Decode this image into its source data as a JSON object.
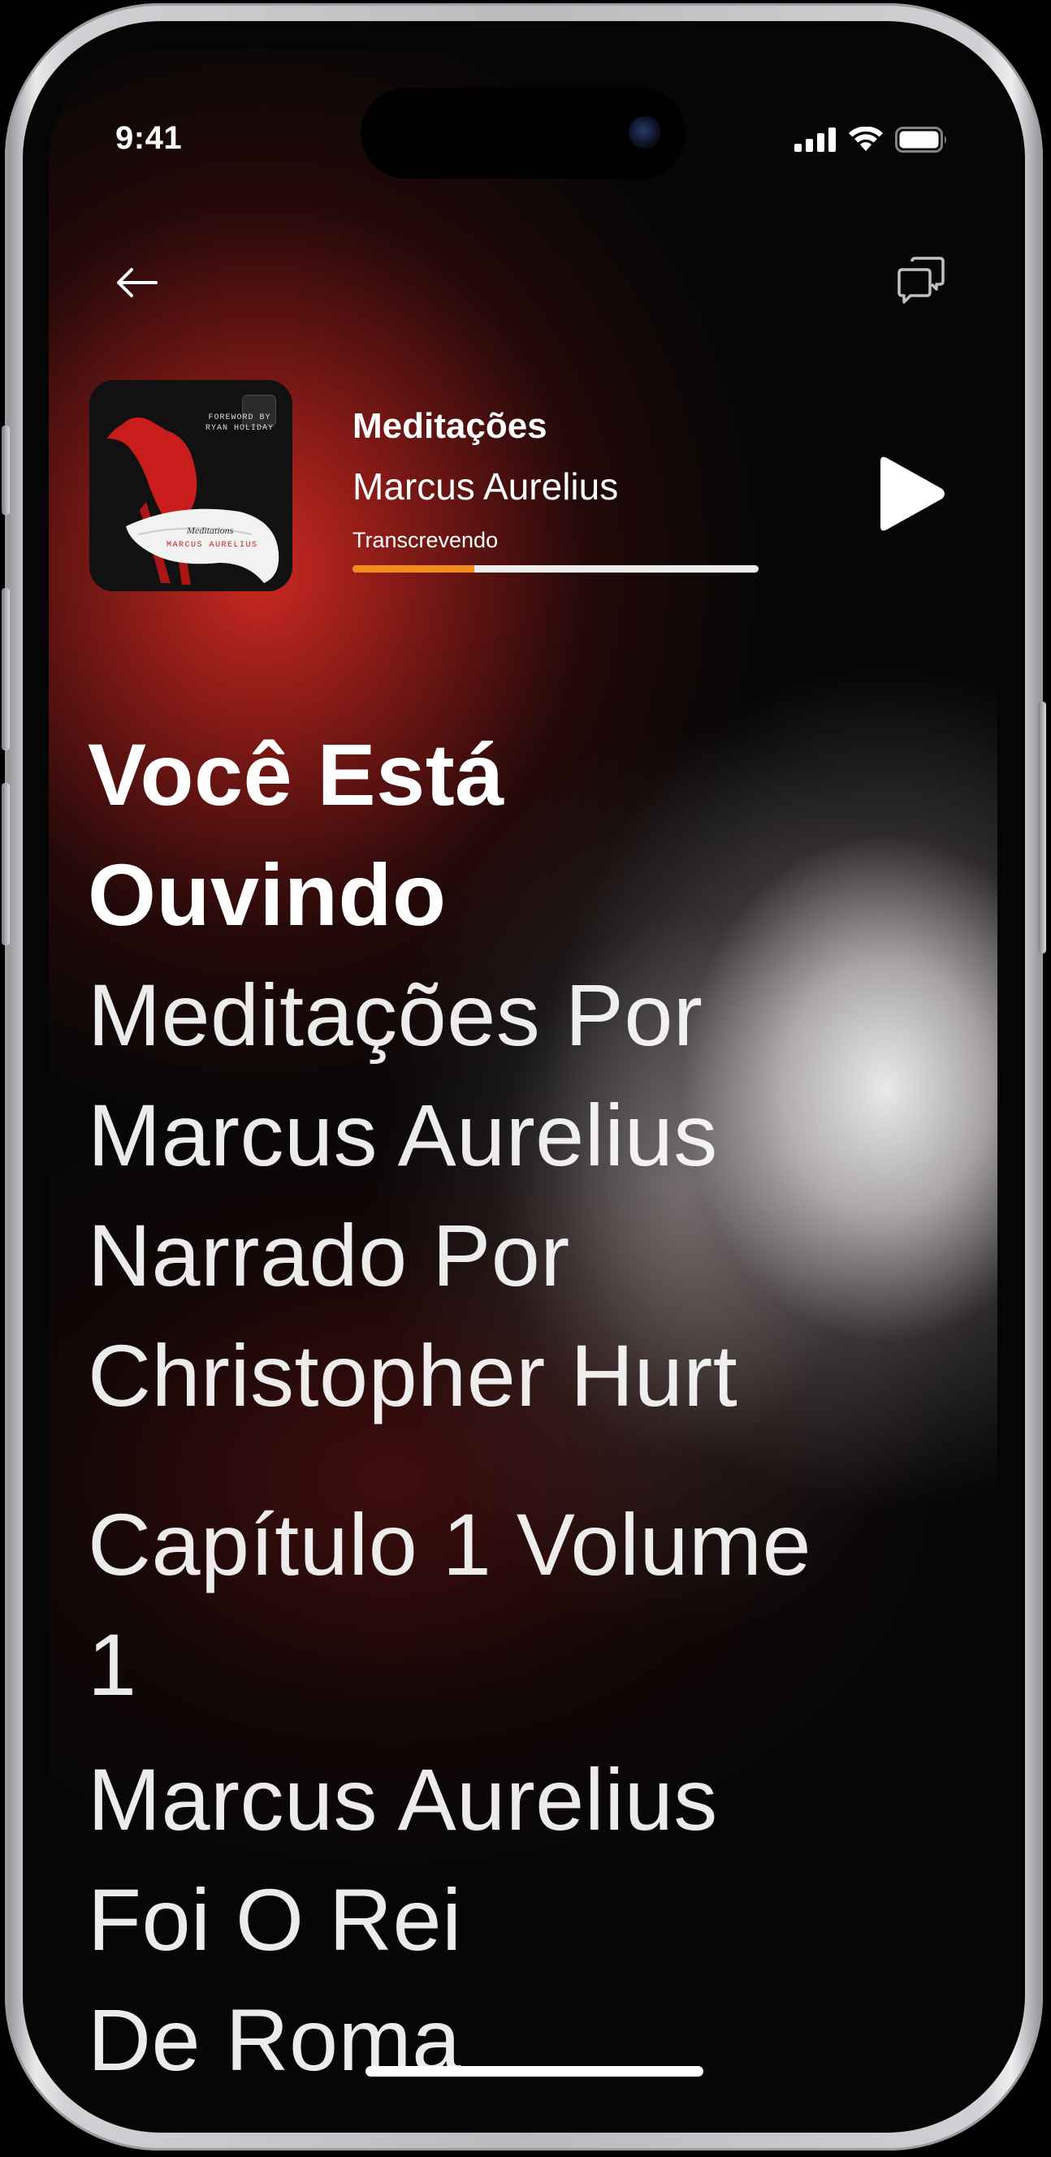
{
  "status_bar": {
    "time": "9:41",
    "icons": [
      "cellular-signal-icon",
      "wifi-icon",
      "battery-icon"
    ]
  },
  "header": {
    "back_icon": "arrow-left-icon",
    "chat_icon": "chat-bubbles-icon"
  },
  "now_playing": {
    "title": "Meditações",
    "author": "Marcus Aurelius",
    "status": "Transcrevendo",
    "progress": 0.3,
    "cover": {
      "top_text": "FOREWORD BY RYAN HOLIDAY",
      "title": "Meditations",
      "author": "MARCUS AURELIUS"
    },
    "play_icon": "play-icon"
  },
  "transcript": {
    "lines": [
      "Você Está",
      "Ouvindo",
      "Meditações Por",
      "Marcus Aurelius",
      "Narrado Por",
      "Christopher Hurt",
      "Capítulo 1 Volume",
      "1",
      "Marcus Aurelius",
      "Foi O Rei",
      "De Roma"
    ]
  },
  "colors": {
    "accent": "#f28a1c",
    "red_glow": "#d72a22",
    "text": "#ffffff"
  }
}
